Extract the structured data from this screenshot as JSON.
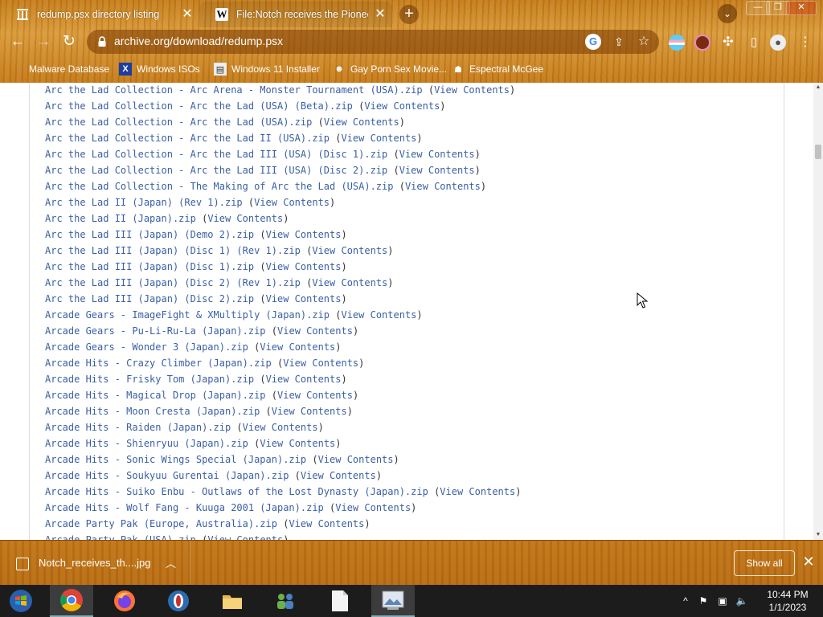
{
  "tabs": [
    {
      "title": "redump.psx directory listing",
      "favicon": "archive-icon"
    },
    {
      "title": "File:Notch receives the Pioneer A",
      "favicon": "wikipedia-icon"
    }
  ],
  "toolbar": {
    "url": "archive.org/download/redump.psx"
  },
  "bookmarks": [
    {
      "label": "Malware Database",
      "icon": "malware-icon"
    },
    {
      "label": "Windows ISOs",
      "icon": "x-icon"
    },
    {
      "label": "Windows 11 Installer",
      "icon": "installer-icon"
    },
    {
      "label": "Gay Porn Sex Movie...",
      "icon": "bookmark-icon"
    },
    {
      "label": "Espectral McGee",
      "icon": "bookmark-icon"
    }
  ],
  "file_list": {
    "view_label": "View Contents",
    "files": [
      "Arc the Lad Collection - Arc Arena - Monster Tournament (USA).zip",
      "Arc the Lad Collection - Arc the Lad (USA) (Beta).zip",
      "Arc the Lad Collection - Arc the Lad (USA).zip",
      "Arc the Lad Collection - Arc the Lad II (USA).zip",
      "Arc the Lad Collection - Arc the Lad III (USA) (Disc 1).zip",
      "Arc the Lad Collection - Arc the Lad III (USA) (Disc 2).zip",
      "Arc the Lad Collection - The Making of Arc the Lad (USA).zip",
      "Arc the Lad II (Japan) (Rev 1).zip",
      "Arc the Lad II (Japan).zip",
      "Arc the Lad III (Japan) (Demo 2).zip",
      "Arc the Lad III (Japan) (Disc 1) (Rev 1).zip",
      "Arc the Lad III (Japan) (Disc 1).zip",
      "Arc the Lad III (Japan) (Disc 2) (Rev 1).zip",
      "Arc the Lad III (Japan) (Disc 2).zip",
      "Arcade Gears - ImageFight & XMultiply (Japan).zip",
      "Arcade Gears - Pu-Li-Ru-La (Japan).zip",
      "Arcade Gears - Wonder 3 (Japan).zip",
      "Arcade Hits - Crazy Climber (Japan).zip",
      "Arcade Hits - Frisky Tom (Japan).zip",
      "Arcade Hits - Magical Drop (Japan).zip",
      "Arcade Hits - Moon Cresta (Japan).zip",
      "Arcade Hits - Raiden (Japan).zip",
      "Arcade Hits - Shienryuu (Japan).zip",
      "Arcade Hits - Sonic Wings Special (Japan).zip",
      "Arcade Hits - Soukyuu Gurentai (Japan).zip",
      "Arcade Hits - Suiko Enbu - Outlaws of the Lost Dynasty (Japan).zip",
      "Arcade Hits - Wolf Fang - Kuuga 2001 (Japan).zip",
      "Arcade Party Pak (Europe, Australia).zip",
      "Arcade Party Pak (USA).zip"
    ]
  },
  "download_shelf": {
    "filename": "Notch_receives_th....jpg",
    "show_all": "Show all"
  },
  "taskbar": {
    "time": "10:44 PM",
    "date": "1/1/2023"
  }
}
